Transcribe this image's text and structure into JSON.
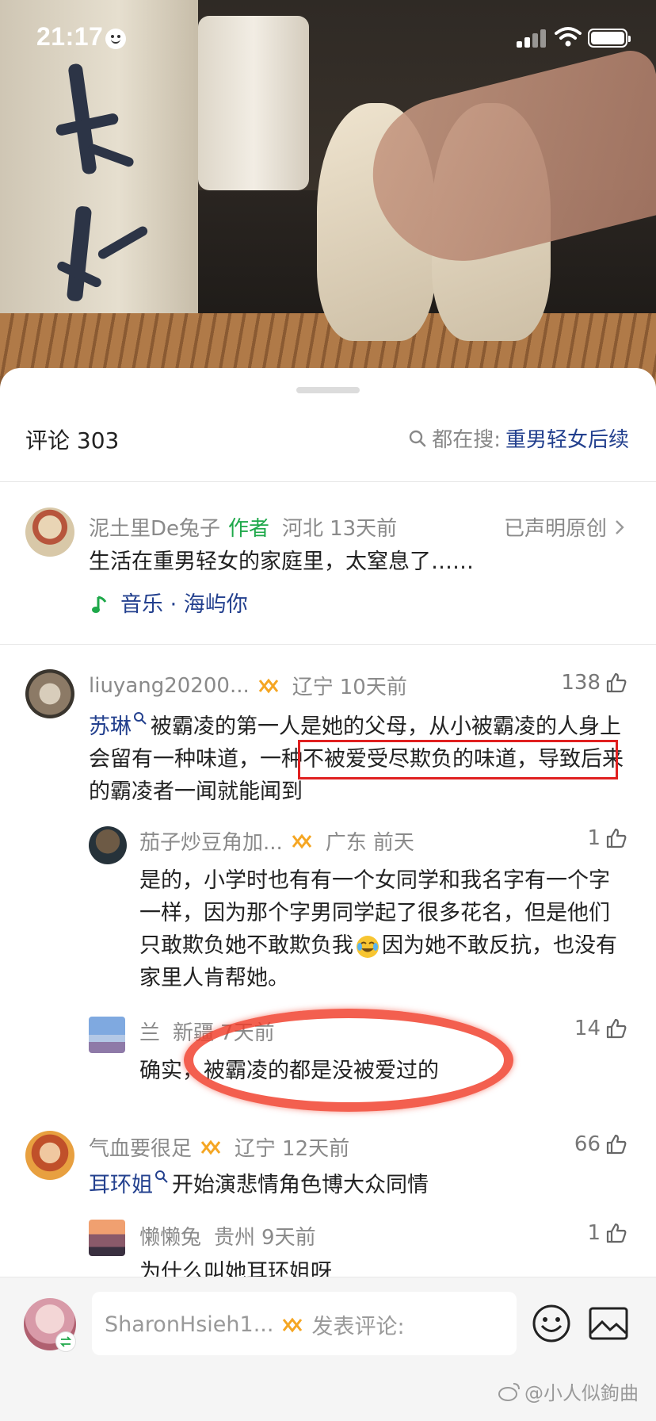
{
  "status_bar": {
    "time": "21:17"
  },
  "header": {
    "comments_label": "评论 303",
    "search_prefix": "都在搜:",
    "search_keyword": "重男轻女后续"
  },
  "post": {
    "username": "泥土里De兔子",
    "author_tag": "作者",
    "location": "河北",
    "time": "13天前",
    "originality": "已声明原创",
    "text": "生活在重男轻女的家庭里，太窒息了……",
    "music_label": "音乐 · 海屿你"
  },
  "comments": [
    {
      "username": "liuyang20200...",
      "location": "辽宁",
      "time": "10天前",
      "likes": "138",
      "mention": "苏琳",
      "text_a": "被霸凌的第一人是她的父母，从小被霸凌的人身上会留有一种味道",
      "text_b": "，一种不被爱受尽欺负的味道，",
      "text_c": "导致后来的霸凌者一闻就能闻到"
    },
    {
      "username": "茄子炒豆角加...",
      "location": "广东",
      "time": "前天",
      "likes": "1",
      "text_a": "是的，小学时也有有一个女同学和我名字有一个字一样，因为那个字男同学起了很多花名，但是他们只敢欺负她不敢欺负我",
      "text_b": "因为她不敢反抗，也没有家里人肯帮她。"
    },
    {
      "username": "兰",
      "location": "新疆",
      "time": "7天前",
      "likes": "14",
      "text": "确实，被霸凌的都是没被爱过的"
    },
    {
      "username": "气血要很足",
      "location": "辽宁",
      "time": "12天前",
      "likes": "66",
      "mention": "耳环姐",
      "text": "开始演悲情角色博大众同情"
    },
    {
      "username": "懒懒兔",
      "location": "贵州",
      "time": "9天前",
      "likes": "1",
      "text": "为什么叫她耳环姐呀"
    }
  ],
  "bottom_bar": {
    "username": "SharonHsieh1...",
    "placeholder": "发表评论:"
  },
  "watermark": "@小人似鉤曲",
  "colors": {
    "link": "#23408e",
    "author": "#1ea84a",
    "highlight": "#e02020"
  }
}
